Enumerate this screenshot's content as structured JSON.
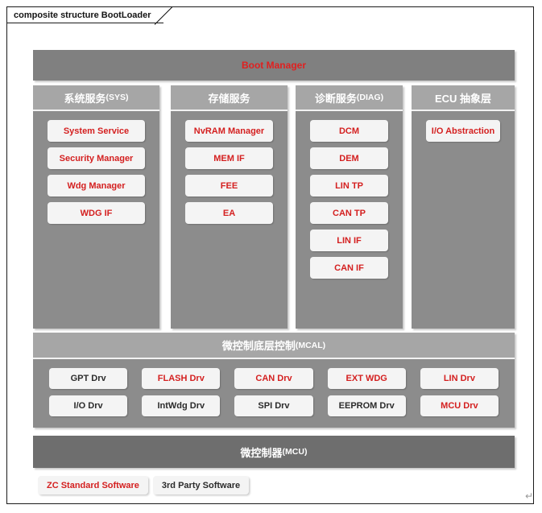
{
  "frame": {
    "tab_label": "composite structure BootLoader"
  },
  "colors": {
    "accent_red": "#d42020",
    "dark_text": "#2b2b2b",
    "panel_gray": "#8c8c8c",
    "header_gray": "#a6a6a6",
    "boot_bar_gray": "#808080",
    "mcu_bar_gray": "#6e6e6e"
  },
  "boot_manager": {
    "label": "Boot Manager"
  },
  "columns": [
    {
      "id": "sys",
      "header_main": "系统服务",
      "header_suffix": "(SYS)",
      "items": [
        {
          "label": "System Service",
          "color": "red"
        },
        {
          "label": "Security Manager",
          "color": "red"
        },
        {
          "label": "Wdg Manager",
          "color": "red"
        },
        {
          "label": "WDG IF",
          "color": "red"
        }
      ]
    },
    {
      "id": "storage",
      "header_main": "存储服务",
      "header_suffix": "",
      "items": [
        {
          "label": "NvRAM Manager",
          "color": "red"
        },
        {
          "label": "MEM IF",
          "color": "red"
        },
        {
          "label": "FEE",
          "color": "red"
        },
        {
          "label": "EA",
          "color": "red"
        }
      ]
    },
    {
      "id": "diag",
      "header_main": "诊断服务",
      "header_suffix": "(DIAG)",
      "items": [
        {
          "label": "DCM",
          "color": "red"
        },
        {
          "label": "DEM",
          "color": "red"
        },
        {
          "label": "LIN TP",
          "color": "red"
        },
        {
          "label": "CAN TP",
          "color": "red"
        },
        {
          "label": "LIN IF",
          "color": "red"
        },
        {
          "label": "CAN IF",
          "color": "red"
        }
      ]
    },
    {
      "id": "ecu",
      "header_main": "ECU 抽象层",
      "header_suffix": "",
      "items": [
        {
          "label": "I/O Abstraction",
          "color": "red"
        }
      ]
    }
  ],
  "mcal": {
    "header_main": "微控制底层控制",
    "header_suffix": "(MCAL)",
    "items": [
      {
        "label": "GPT Drv",
        "color": "dark"
      },
      {
        "label": "FLASH Drv",
        "color": "red"
      },
      {
        "label": "CAN Drv",
        "color": "red"
      },
      {
        "label": "EXT WDG",
        "color": "red"
      },
      {
        "label": "LIN Drv",
        "color": "red"
      },
      {
        "label": "I/O Drv",
        "color": "dark"
      },
      {
        "label": "IntWdg Drv",
        "color": "dark"
      },
      {
        "label": "SPI Drv",
        "color": "dark"
      },
      {
        "label": "EEPROM Drv",
        "color": "dark"
      },
      {
        "label": "MCU Drv",
        "color": "red"
      }
    ]
  },
  "mcu": {
    "header_main": "微控制器",
    "header_suffix": "(MCU)"
  },
  "legend": [
    {
      "label": "ZC Standard Software",
      "color": "red"
    },
    {
      "label": "3rd Party Software",
      "color": "dark"
    }
  ],
  "resize_handle": {
    "glyph": "↵"
  }
}
